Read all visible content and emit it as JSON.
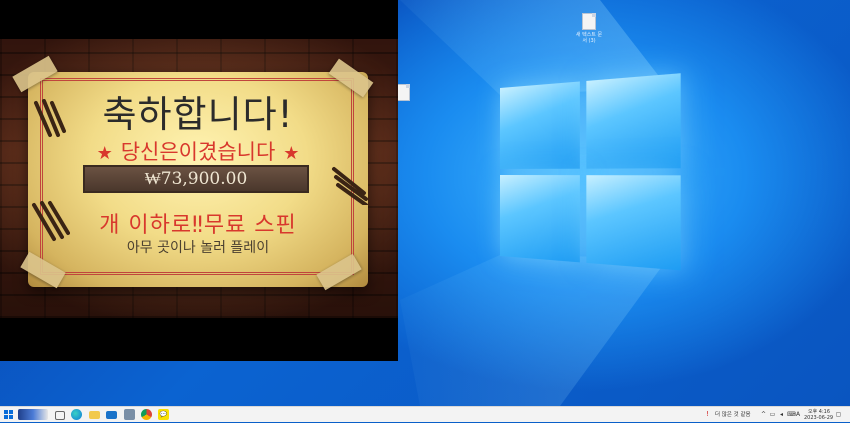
{
  "player": {
    "congrats": "축하합니다!",
    "you_won": "당신은이겼습니다",
    "star": "★",
    "amount": "₩73,900.00",
    "free_spins": "개 이하로‼무료 스핀",
    "play_anywhere": "아무 곳이나 놀러 플레이"
  },
  "desktop": {
    "icons": [
      {
        "name": "file-icon-1",
        "label": "새 텍스트 문서 (3)"
      },
      {
        "name": "file-icon-2",
        "label": ""
      }
    ]
  },
  "taskbar": {
    "start_icon": "windows-start-icon",
    "apps": [
      "task-view-icon",
      "edge-icon",
      "file-explorer-icon",
      "mail-icon",
      "store-icon",
      "chrome-icon",
      "kakaotalk-icon"
    ],
    "notification_text": "더 많은 것 같음",
    "tray_ime": "A",
    "clock_time": "오후 4:16",
    "clock_date": "2023-06-29"
  },
  "colors": {
    "accent_red": "#d8382d",
    "wallpaper_blue": "#0b63d1"
  }
}
